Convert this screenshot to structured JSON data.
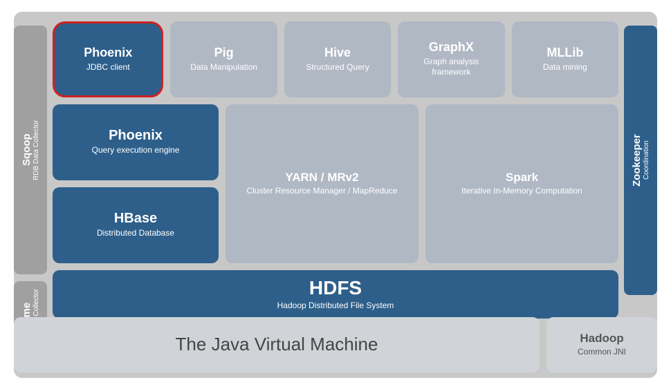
{
  "sqoop": {
    "title": "Sqoop",
    "sub": "RDB Data Collector"
  },
  "flume": {
    "title": "Flume",
    "sub": "Log Data Collector"
  },
  "zookeeper": {
    "title": "Zookeeper",
    "sub": "Coordination"
  },
  "top_tools": [
    {
      "id": "phoenix",
      "title": "Phoenix",
      "sub": "JDBC client",
      "highlighted": true
    },
    {
      "id": "pig",
      "title": "Pig",
      "sub": "Data Manipulation"
    },
    {
      "id": "hive",
      "title": "Hive",
      "sub": "Structured Query"
    },
    {
      "id": "graphx",
      "title": "GraphX",
      "sub": "Graph analysis framework"
    },
    {
      "id": "mllib",
      "title": "MLLib",
      "sub": "Data mining"
    }
  ],
  "phoenix_engine": {
    "title": "Phoenix",
    "sub": "Query execution engine"
  },
  "hbase": {
    "title": "HBase",
    "sub": "Distributed Database"
  },
  "yarn": {
    "title": "YARN / MRv2",
    "sub": "Cluster Resource Manager / MapReduce"
  },
  "spark": {
    "title": "Spark",
    "sub": "Iterative In-Memory Computation"
  },
  "hdfs": {
    "title": "HDFS",
    "sub": "Hadoop Distributed File System"
  },
  "jvm": {
    "title": "The Java Virtual Machine"
  },
  "hadoop_common": {
    "title": "Hadoop",
    "sub": "Common JNI"
  }
}
